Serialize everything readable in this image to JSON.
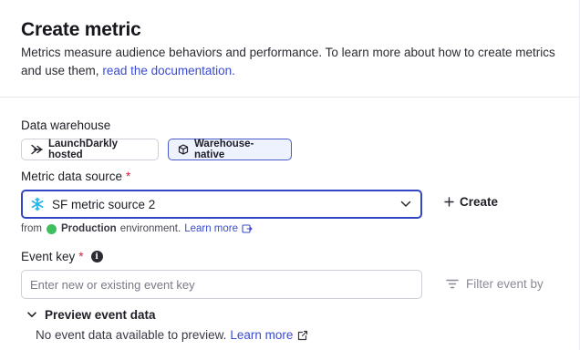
{
  "header": {
    "title": "Create metric",
    "description": "Metrics measure audience behaviors and performance. To learn more about how to create metrics and use them,",
    "doc_link": "read the documentation."
  },
  "warehouse": {
    "label": "Data warehouse",
    "options": [
      {
        "label": "LaunchDarkly hosted",
        "icon": "launchdarkly-arrow-icon",
        "selected": false
      },
      {
        "label": "Warehouse-native",
        "icon": "cube-icon",
        "selected": true
      }
    ]
  },
  "data_source": {
    "label": "Metric data source",
    "required_mark": "*",
    "selected": "SF metric source 2",
    "icon": "snowflake-icon",
    "create_label": "Create",
    "from_prefix": "from",
    "environment": "Production",
    "environment_suffix": "environment.",
    "learn_more": "Learn more",
    "environment_color": "#3fbf5f"
  },
  "event_key": {
    "label": "Event key",
    "required_mark": "*",
    "info_glyph": "i",
    "placeholder": "Enter new or existing event key",
    "value": "",
    "filter_label": "Filter event by"
  },
  "preview": {
    "toggle_label": "Preview event data",
    "empty_text": "No event data available to preview.",
    "learn_more": "Learn more"
  },
  "colors": {
    "accent": "#3346c4",
    "link": "#3b4bcf",
    "required": "#d6203b",
    "snowflake": "#29b5e8"
  }
}
